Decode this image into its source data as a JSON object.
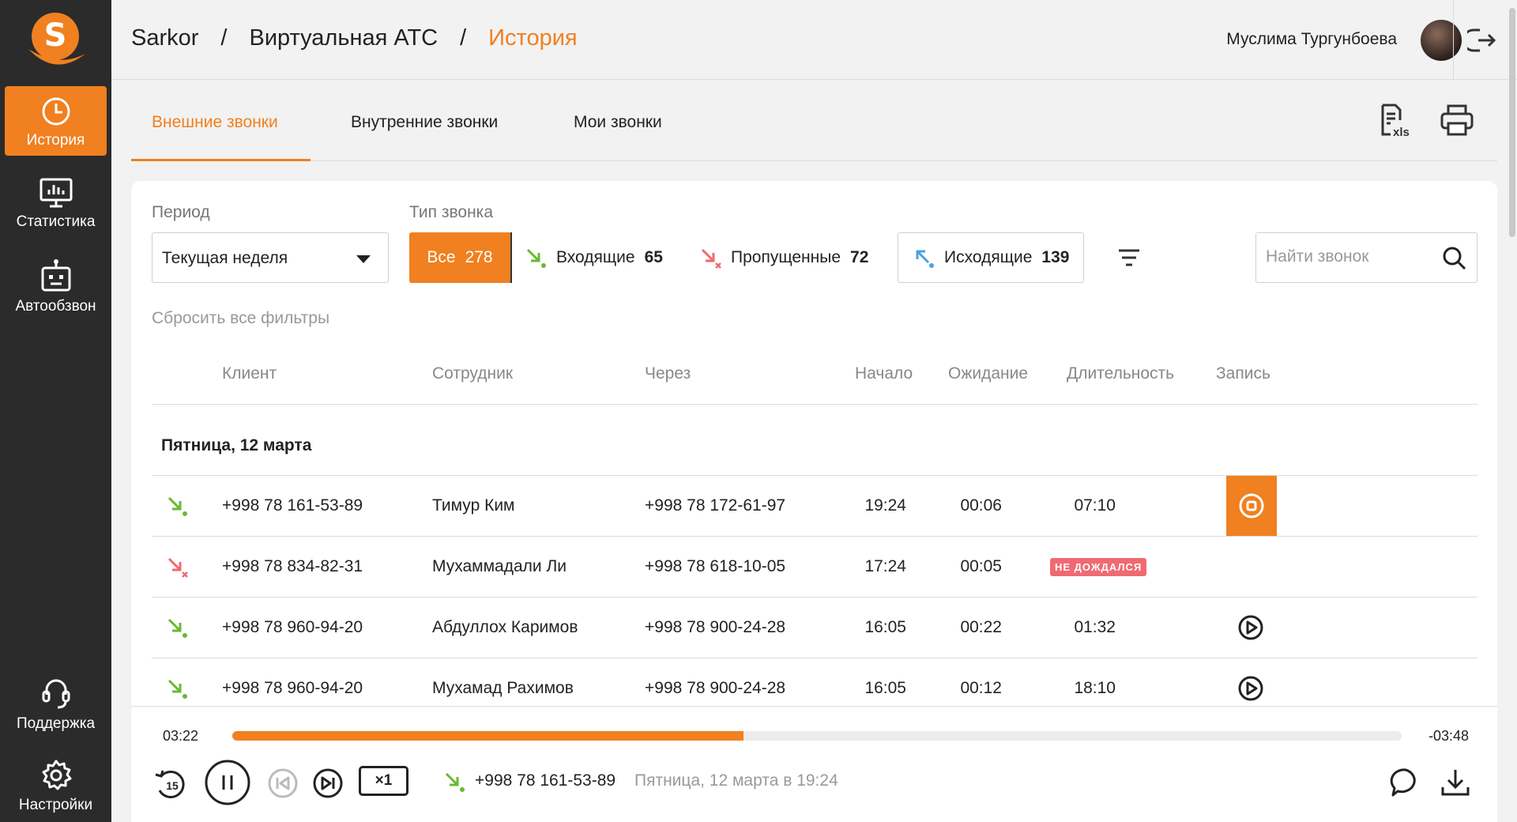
{
  "brand": {
    "logo_letter": "S",
    "accent": "#f08020",
    "sidebar_bg": "#2b2b2b"
  },
  "sidebar": {
    "items": [
      {
        "label": "История",
        "icon": "clock-icon",
        "active": true
      },
      {
        "label": "Статистика",
        "icon": "monitor-chart-icon",
        "active": false
      },
      {
        "label": "Автообзвон",
        "icon": "robot-icon",
        "active": false
      }
    ],
    "bottom": [
      {
        "label": "Поддержка",
        "icon": "headset-icon"
      },
      {
        "label": "Настройки",
        "icon": "gear-icon"
      }
    ]
  },
  "header": {
    "breadcrumb": [
      "Sarkor",
      "Виртуальная АТС",
      "История"
    ],
    "separator": "/",
    "user_name": "Муслима Тургунбоева"
  },
  "tabs": [
    {
      "label": "Внешние звонки",
      "active": true
    },
    {
      "label": "Внутренние звонки",
      "active": false
    },
    {
      "label": "Мои звонки",
      "active": false
    }
  ],
  "tools": {
    "xls_label": "xls"
  },
  "filters": {
    "period_label": "Период",
    "period_value": "Текущая неделя",
    "type_label": "Тип звонка",
    "types": [
      {
        "label": "Все",
        "count": "278",
        "active": true
      },
      {
        "label": "Входящие",
        "count": "65",
        "icon": "incoming-call-icon"
      },
      {
        "label": "Пропущенные",
        "count": "72",
        "icon": "missed-call-icon"
      },
      {
        "label": "Исходящие",
        "count": "139",
        "icon": "outgoing-call-icon"
      }
    ],
    "search_placeholder": "Найти звонок",
    "reset_label": "Сбросить все фильтры"
  },
  "table": {
    "columns": [
      "Клиент",
      "Сотрудник",
      "Через",
      "Начало",
      "Ожидание",
      "Длительность",
      "Запись"
    ],
    "group_label": "Пятница, 12 марта",
    "rows": [
      {
        "type": "incoming",
        "client": "+998 78 161-53-89",
        "employee": "Тимур Ким",
        "via": "+998 78 172-61-97",
        "start": "19:24",
        "wait": "00:06",
        "duration": "07:10",
        "record": "playing"
      },
      {
        "type": "missed",
        "client": "+998 78 834-82-31",
        "employee": "Мухаммадали Ли",
        "via": "+998 78 618-10-05",
        "start": "17:24",
        "wait": "00:05",
        "duration": "НЕ ДОЖДАЛСЯ",
        "record": "none"
      },
      {
        "type": "incoming",
        "client": "+998 78 960-94-20",
        "employee": "Абдуллох Каримов",
        "via": "+998 78 900-24-28",
        "start": "16:05",
        "wait": "00:22",
        "duration": "01:32",
        "record": "play"
      },
      {
        "type": "incoming",
        "client": "+998 78 960-94-20",
        "employee": "Мухамад Рахимов",
        "via": "+998 78 900-24-28",
        "start": "16:05",
        "wait": "00:12",
        "duration": "18:10",
        "record": "play"
      }
    ]
  },
  "player": {
    "elapsed": "03:22",
    "remaining": "-03:48",
    "progress": 0.437,
    "speed": "×1",
    "rewind_label": "15",
    "number": "+998 78 161-53-89",
    "date": "Пятница, 12 марта в 19:24"
  }
}
